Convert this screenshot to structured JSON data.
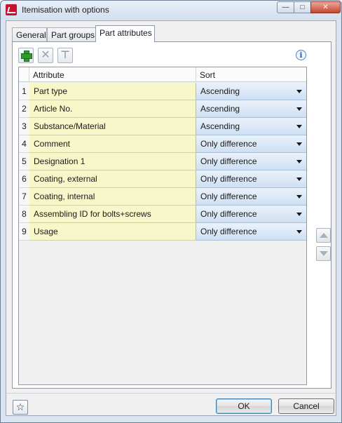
{
  "window": {
    "title": "Itemisation with options",
    "min_glyph": "—",
    "max_glyph": "□",
    "close_glyph": "✕"
  },
  "tabs": [
    {
      "label": "General",
      "active": false
    },
    {
      "label": "Part groups",
      "active": false
    },
    {
      "label": "Part attributes",
      "active": true
    }
  ],
  "toolbar": {
    "add_icon": "plus-icon",
    "delete_icon": "x-icon",
    "tool_icon": "t-icon",
    "delete_glyph": "✕",
    "tool_glyph": "⊤",
    "info_glyph": "i"
  },
  "grid": {
    "headers": {
      "attribute": "Attribute",
      "sort": "Sort"
    },
    "rows": [
      {
        "num": "1",
        "attribute": "Part type",
        "sort": "Ascending"
      },
      {
        "num": "2",
        "attribute": "Article No.",
        "sort": "Ascending"
      },
      {
        "num": "3",
        "attribute": "Substance/Material",
        "sort": "Ascending"
      },
      {
        "num": "4",
        "attribute": "Comment",
        "sort": "Only difference"
      },
      {
        "num": "5",
        "attribute": "Designation 1",
        "sort": "Only difference"
      },
      {
        "num": "6",
        "attribute": "Coating, external",
        "sort": "Only difference"
      },
      {
        "num": "7",
        "attribute": "Coating, internal",
        "sort": "Only difference"
      },
      {
        "num": "8",
        "attribute": "Assembling ID for bolts+screws",
        "sort": "Only difference"
      },
      {
        "num": "9",
        "attribute": "Usage",
        "sort": "Only difference"
      }
    ]
  },
  "footer": {
    "favorite_glyph": "☆",
    "ok_label": "OK",
    "cancel_label": "Cancel"
  },
  "colors": {
    "attribute_cell_bg": "#f7f7c9",
    "sort_cell_bg": "#dce8f6",
    "window_frame": "#dbe5f1"
  }
}
